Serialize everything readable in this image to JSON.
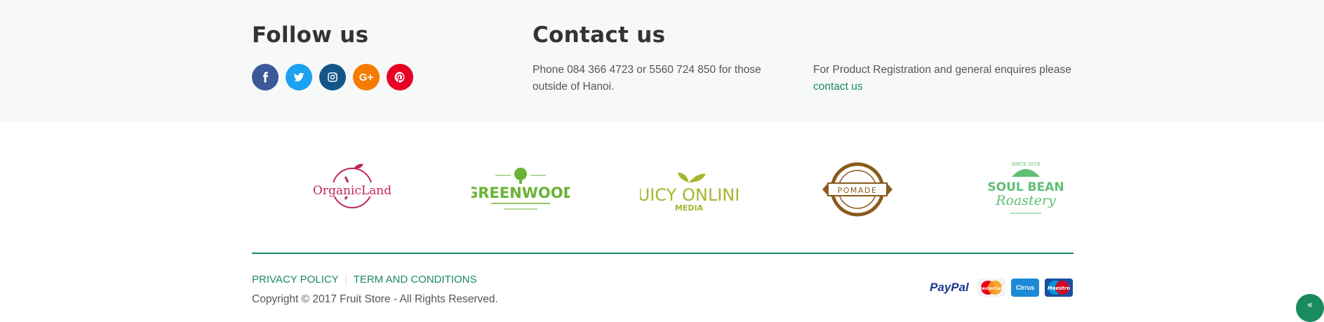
{
  "follow": {
    "title": "Follow us",
    "icons": [
      {
        "name": "facebook-icon",
        "glyph": "f",
        "color": "#3b5998"
      },
      {
        "name": "twitter-icon",
        "glyph": "",
        "color": "#1da1f2"
      },
      {
        "name": "instagram-icon",
        "glyph": "",
        "color": "#125688"
      },
      {
        "name": "google-plus-icon",
        "glyph": "G+",
        "color": "#f57c00"
      },
      {
        "name": "pinterest-icon",
        "glyph": "P",
        "color": "#e60023"
      }
    ]
  },
  "contact": {
    "title": "Contact us",
    "phone_text": "Phone 084 366 4723 or 5560 724 850 for those outside of Hanoi.",
    "registration_text": "For Product Registration and general enquires please",
    "contact_link": "contact us"
  },
  "brands": [
    {
      "name": "OrganicLand",
      "color": "#c1245a"
    },
    {
      "name": "GREENWOOD",
      "color": "#6ab335"
    },
    {
      "name": "JUICY ONLINE",
      "color": "#a7b52b"
    },
    {
      "name": "POMADE",
      "color": "#8b5a1e"
    },
    {
      "name": "SOUL BEAN",
      "color": "#5fbf73"
    }
  ],
  "footer": {
    "privacy_label": "PRIVACY POLICY",
    "terms_label": "TERM AND CONDITIONS",
    "copyright": "Copyright © 2017 Fruit Store - All Rights Reserved.",
    "accent": "#1a8a5f"
  },
  "payments": {
    "paypal": "PayPal",
    "mastercard": "MasterCard",
    "cirrus": "Cirrus",
    "maestro": "Maestro"
  },
  "back_to_top": "«"
}
